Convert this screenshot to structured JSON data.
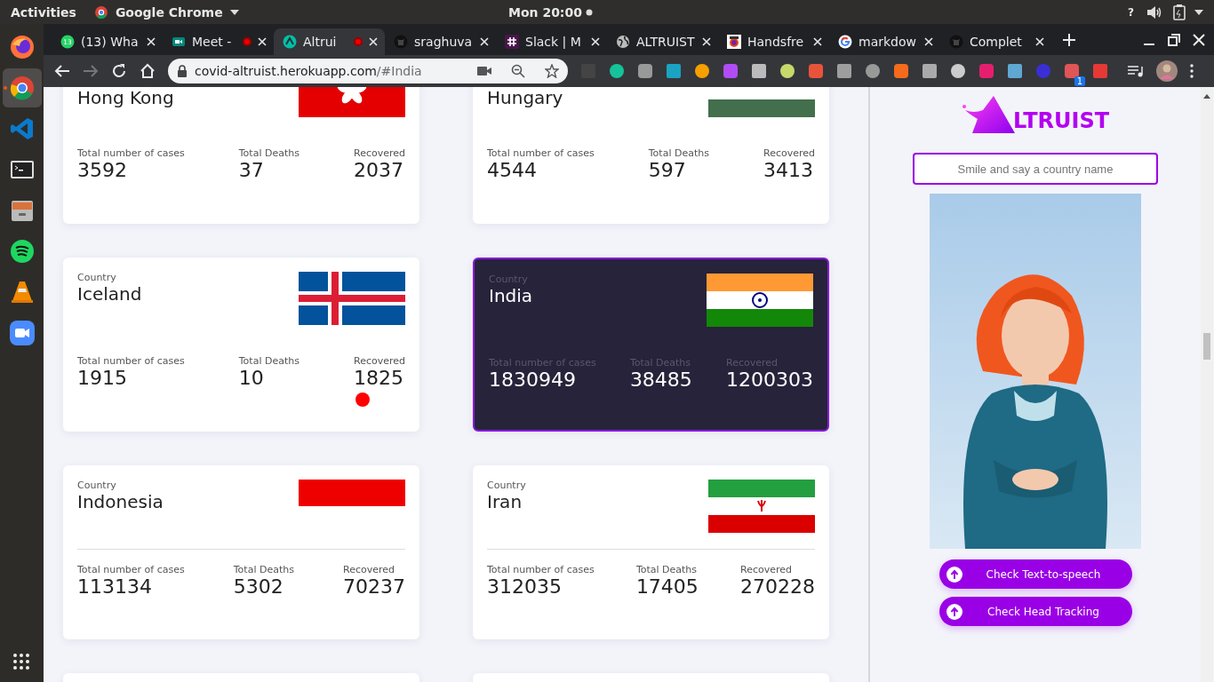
{
  "top_bar": {
    "activities": "Activities",
    "app_name": "Google Chrome",
    "clock": "Mon 20:00",
    "help": "?"
  },
  "dock": [
    {
      "kind": "firefox",
      "selected": false
    },
    {
      "kind": "chrome",
      "selected": true
    },
    {
      "kind": "vscode",
      "selected": false
    },
    {
      "kind": "terminal",
      "selected": false
    },
    {
      "kind": "files",
      "selected": false
    },
    {
      "kind": "spotify",
      "selected": false
    },
    {
      "kind": "vlc",
      "selected": false
    },
    {
      "kind": "zoom",
      "selected": false
    }
  ],
  "tabs": [
    {
      "title": "(13) Wha",
      "badge": "13",
      "recording": false,
      "selected": false
    },
    {
      "title": "Meet -",
      "recording": true,
      "selected": false
    },
    {
      "title": "Altrui",
      "recording": true,
      "selected": true
    },
    {
      "title": "sraghuva",
      "recording": false,
      "selected": false
    },
    {
      "title": "Slack | M",
      "recording": false,
      "selected": false
    },
    {
      "title": "ALTRUIST",
      "recording": false,
      "selected": false
    },
    {
      "title": "Handsfre",
      "recording": false,
      "selected": false
    },
    {
      "title": "markdow",
      "recording": false,
      "selected": false
    },
    {
      "title": "Complet",
      "recording": false,
      "selected": false
    }
  ],
  "nav": {
    "forward_disabled": true
  },
  "address_bar": {
    "host": "covid-altruist.herokuapp.com",
    "path": "/#India"
  },
  "extension_badge": "1",
  "cards": [
    {
      "name": "Hong Kong",
      "selected": false,
      "divider": false,
      "alert_dot": false,
      "stats": [
        {
          "label": "Total number of cases",
          "value": "3592"
        },
        {
          "label": "Total Deaths",
          "value": "37"
        },
        {
          "label": "Recovered",
          "value": "2037"
        }
      ]
    },
    {
      "name": "Hungary",
      "selected": false,
      "divider": false,
      "alert_dot": false,
      "stats": [
        {
          "label": "Total number of cases",
          "value": "4544"
        },
        {
          "label": "Total Deaths",
          "value": "597"
        },
        {
          "label": "Recovered",
          "value": "3413"
        }
      ]
    },
    {
      "country_label": "Country",
      "name": "Iceland",
      "selected": false,
      "divider": false,
      "alert_dot": true,
      "stats": [
        {
          "label": "Total number of cases",
          "value": "1915"
        },
        {
          "label": "Total Deaths",
          "value": "10"
        },
        {
          "label": "Recovered",
          "value": "1825"
        }
      ]
    },
    {
      "country_label": "Country",
      "name": "India",
      "selected": true,
      "divider": false,
      "alert_dot": false,
      "stats": [
        {
          "label": "Total number of cases",
          "value": "1830949"
        },
        {
          "label": "Total Deaths",
          "value": "38485"
        },
        {
          "label": "Recovered",
          "value": "1200303"
        }
      ]
    },
    {
      "country_label": "Country",
      "name": "Indonesia",
      "selected": false,
      "divider": true,
      "alert_dot": false,
      "stats": [
        {
          "label": "Total number of cases",
          "value": "113134"
        },
        {
          "label": "Total Deaths",
          "value": "5302"
        },
        {
          "label": "Recovered",
          "value": "70237"
        }
      ]
    },
    {
      "country_label": "Country",
      "name": "Iran",
      "selected": false,
      "divider": true,
      "alert_dot": false,
      "stats": [
        {
          "label": "Total number of cases",
          "value": "312035"
        },
        {
          "label": "Total Deaths",
          "value": "17405"
        },
        {
          "label": "Recovered",
          "value": "270228"
        }
      ]
    }
  ],
  "sidebar": {
    "logo_text": "LTRUIST",
    "search": {
      "placeholder": "Smile and say a country name"
    },
    "avatar": {
      "kind": "picture"
    },
    "buttons": [
      "Check Text-to-speech",
      "Check Head Tracking"
    ]
  }
}
